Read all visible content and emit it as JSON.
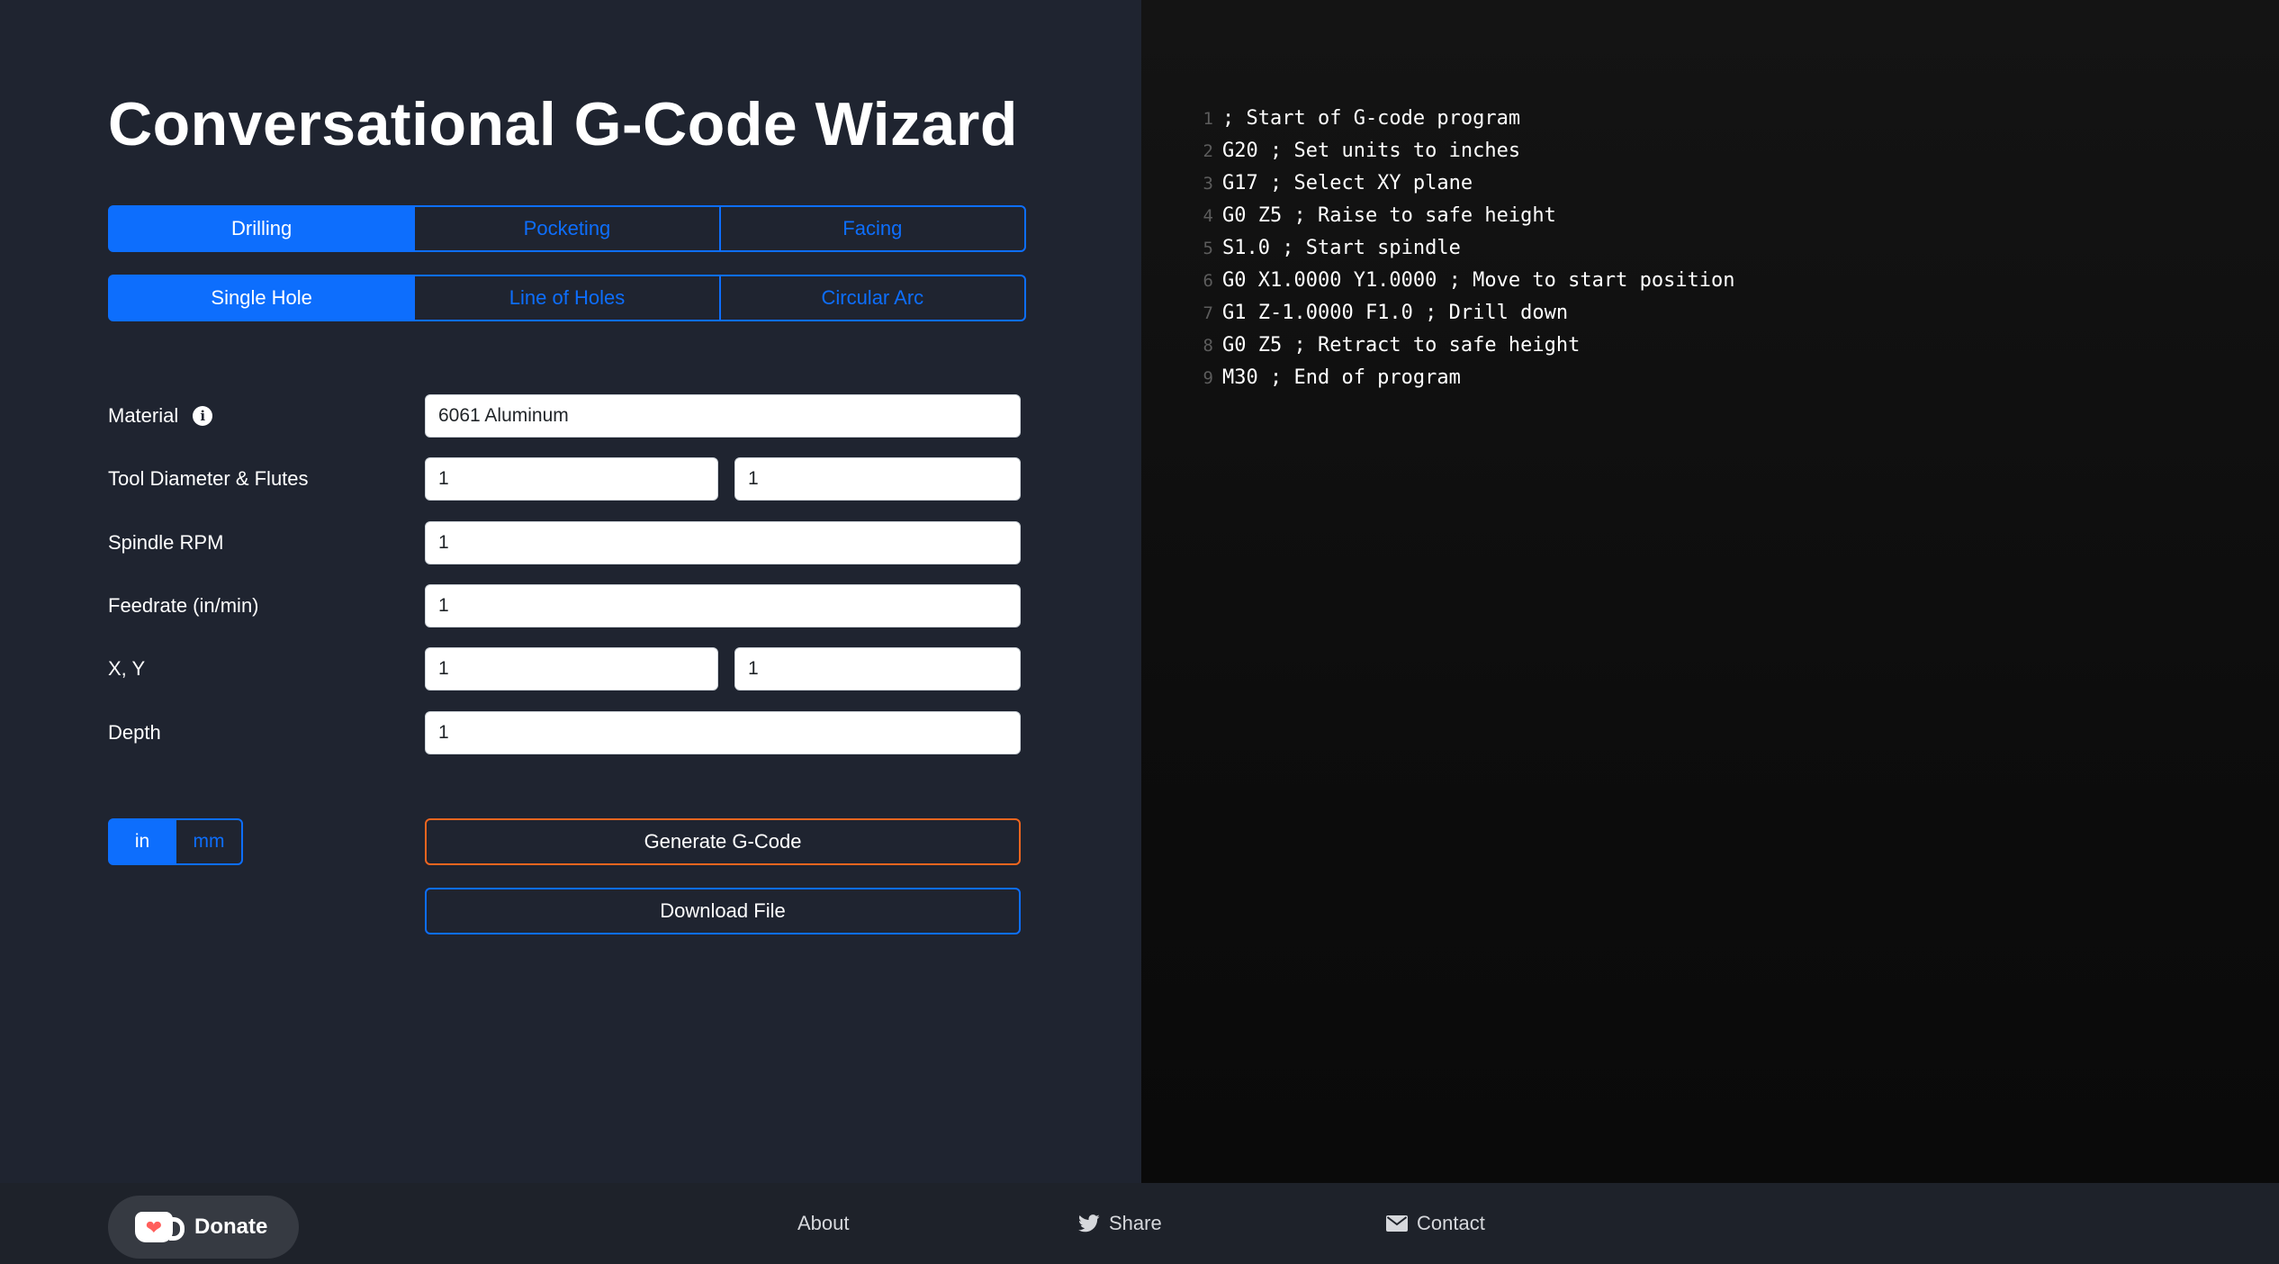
{
  "page": {
    "title": "Conversational G-Code Wizard"
  },
  "operations": {
    "tabs": [
      {
        "label": "Drilling",
        "active": true
      },
      {
        "label": "Pocketing",
        "active": false
      },
      {
        "label": "Facing",
        "active": false
      }
    ]
  },
  "patterns": {
    "tabs": [
      {
        "label": "Single Hole",
        "active": true
      },
      {
        "label": "Line of Holes",
        "active": false
      },
      {
        "label": "Circular Arc",
        "active": false
      }
    ]
  },
  "form": {
    "material": {
      "label": "Material",
      "value": "6061 Aluminum",
      "info_icon": "info-icon"
    },
    "tool": {
      "label": "Tool Diameter & Flutes",
      "diameter": "1",
      "flutes": "1"
    },
    "spindle": {
      "label": "Spindle RPM",
      "value": "1"
    },
    "feedrate": {
      "label": "Feedrate (in/min)",
      "value": "1"
    },
    "xy": {
      "label": "X, Y",
      "x": "1",
      "y": "1"
    },
    "depth": {
      "label": "Depth",
      "value": "1"
    }
  },
  "units": {
    "options": [
      {
        "label": "in",
        "active": true
      },
      {
        "label": "mm",
        "active": false
      }
    ]
  },
  "actions": {
    "generate_label": "Generate G-Code",
    "download_label": "Download File"
  },
  "code": {
    "lines": [
      {
        "no": "1",
        "text": "; Start of G-code program"
      },
      {
        "no": "2",
        "text": "G20 ; Set units to inches"
      },
      {
        "no": "3",
        "text": "G17 ; Select XY plane"
      },
      {
        "no": "4",
        "text": "G0 Z5 ; Raise to safe height"
      },
      {
        "no": "5",
        "text": "S1.0 ; Start spindle"
      },
      {
        "no": "6",
        "text": "G0 X1.0000 Y1.0000 ; Move to start position"
      },
      {
        "no": "7",
        "text": "G1 Z-1.0000 F1.0 ; Drill down"
      },
      {
        "no": "8",
        "text": "G0 Z5 ; Retract to safe height"
      },
      {
        "no": "9",
        "text": "M30 ; End of program"
      }
    ]
  },
  "footer": {
    "donate_label": "Donate",
    "about_label": "About",
    "share_label": "Share",
    "contact_label": "Contact"
  },
  "colors": {
    "accent": "#0d6efd",
    "generate_border": "#f0651f",
    "background": "#1f2430",
    "code_background": "#0d0d0d",
    "heart": "#ff5e5b"
  }
}
